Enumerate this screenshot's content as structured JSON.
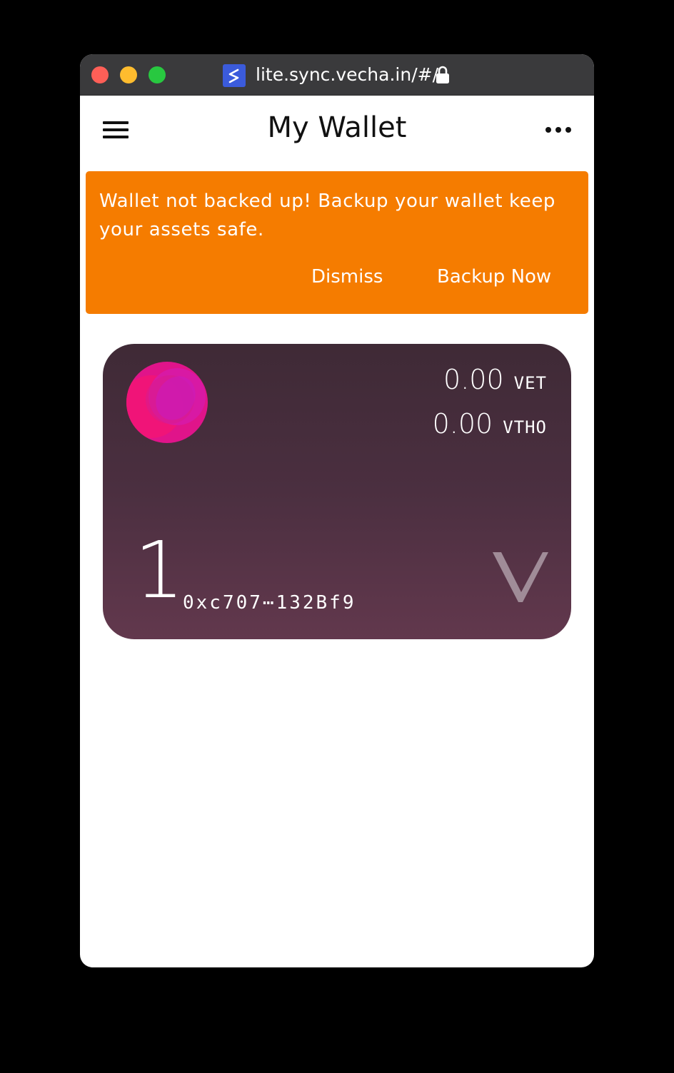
{
  "browser": {
    "url": "lite.sync.vecha.in/#/"
  },
  "appbar": {
    "title": "My Wallet"
  },
  "banner": {
    "message": "Wallet not backed up! Backup your wallet keep your assets safe.",
    "dismiss_label": "Dismiss",
    "backup_label": "Backup Now",
    "color": "#f57c00"
  },
  "wallet_card": {
    "index": "1",
    "address": "0xc707⋯132Bf9",
    "balances": [
      {
        "amount": "0.00",
        "symbol": "VET"
      },
      {
        "amount": "0.00",
        "symbol": "VTHO"
      }
    ],
    "avatar_color": "#e0148a"
  },
  "icons": {
    "menu": "hamburger-menu-icon",
    "more": "more-horizontal-icon",
    "lock": "lock-icon",
    "site": "sync-site-icon",
    "brand": "vechain-logo-icon"
  }
}
